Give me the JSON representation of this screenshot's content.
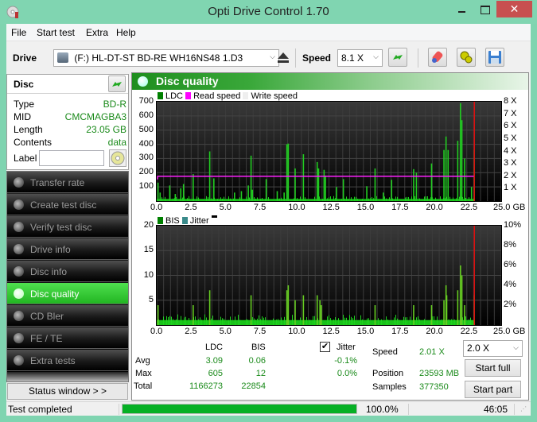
{
  "window": {
    "title": "Opti Drive Control 1.70",
    "close_glyph": "✕"
  },
  "menu": [
    "File",
    "Start test",
    "Extra",
    "Help"
  ],
  "toolbar": {
    "drive_label": "Drive",
    "drive_value": "(F:)  HL-DT-ST BD-RE  WH16NS48 1.D3",
    "speed_label": "Speed",
    "speed_value": "8.1 X",
    "icons": [
      "eject-icon",
      "refresh-icon",
      "erase-icon",
      "settings-icon",
      "save-icon"
    ]
  },
  "disc": {
    "header": "Disc",
    "rows": [
      {
        "label": "Type",
        "value": "BD-R"
      },
      {
        "label": "MID",
        "value": "CMCMAGBA3"
      },
      {
        "label": "Length",
        "value": "23.05 GB"
      },
      {
        "label": "Contents",
        "value": "data"
      }
    ],
    "label_field": {
      "label": "Label",
      "value": ""
    }
  },
  "nav": [
    {
      "label": "Transfer rate",
      "active": false
    },
    {
      "label": "Create test disc",
      "active": false
    },
    {
      "label": "Verify test disc",
      "active": false
    },
    {
      "label": "Drive info",
      "active": false
    },
    {
      "label": "Disc info",
      "active": false
    },
    {
      "label": "Disc quality",
      "active": true
    },
    {
      "label": "CD Bler",
      "active": false
    },
    {
      "label": "FE / TE",
      "active": false
    },
    {
      "label": "Extra tests",
      "active": false
    }
  ],
  "status_window_label": "Status window > >",
  "panel": {
    "title": "Disc quality"
  },
  "chart_data": [
    {
      "type": "bar",
      "title": "LDC",
      "legend": [
        "LDC",
        "Read speed",
        "Write speed"
      ],
      "legend_colors": {
        "LDC": "#008000",
        "Read speed": "#ff00ff",
        "Write speed": "#f0f0f0"
      },
      "xlabel": "GB",
      "x_ticks": [
        "0.0",
        "2.5",
        "5.0",
        "7.5",
        "10.0",
        "12.5",
        "15.0",
        "17.5",
        "20.0",
        "22.5",
        "25.0 GB"
      ],
      "xlim": [
        0,
        25
      ],
      "ylim": [
        0,
        700
      ],
      "y_ticks": [
        "700",
        "600",
        "500",
        "400",
        "300",
        "200",
        "100"
      ],
      "y2_ticks": [
        "8 X",
        "7 X",
        "6 X",
        "5 X",
        "4 X",
        "3 X",
        "2 X",
        "1 X"
      ],
      "y2lim": [
        0,
        8
      ],
      "end_marker_gb": 23.05,
      "read_speed_x": 2.0,
      "peaks": [
        [
          0.05,
          130
        ],
        [
          0.2,
          60
        ],
        [
          0.9,
          110
        ],
        [
          1.3,
          50
        ],
        [
          1.7,
          90
        ],
        [
          1.9,
          120
        ],
        [
          2.6,
          190
        ],
        [
          3.8,
          350
        ],
        [
          4.1,
          160
        ],
        [
          5.6,
          60
        ],
        [
          6.1,
          70
        ],
        [
          6.6,
          110
        ],
        [
          6.8,
          320
        ],
        [
          6.9,
          80
        ],
        [
          7.9,
          155
        ],
        [
          8.7,
          70
        ],
        [
          9.2,
          60
        ],
        [
          9.4,
          400
        ],
        [
          9.5,
          405
        ],
        [
          10.0,
          230
        ],
        [
          10.6,
          330
        ],
        [
          11.6,
          275
        ],
        [
          11.7,
          230
        ],
        [
          12.1,
          220
        ],
        [
          12.2,
          180
        ],
        [
          13.0,
          100
        ],
        [
          13.5,
          155
        ],
        [
          15.2,
          105
        ],
        [
          15.8,
          230
        ],
        [
          16.4,
          60
        ],
        [
          17.0,
          150
        ],
        [
          18.6,
          225
        ],
        [
          18.8,
          200
        ],
        [
          19.9,
          265
        ],
        [
          20.8,
          360
        ],
        [
          20.95,
          455
        ],
        [
          21.1,
          360
        ],
        [
          21.8,
          425
        ],
        [
          22.0,
          690
        ],
        [
          22.1,
          570
        ],
        [
          22.3,
          300
        ],
        [
          22.8,
          100
        ],
        [
          23.0,
          360
        ]
      ],
      "baseline": 15
    },
    {
      "type": "bar",
      "title": "BIS",
      "legend": [
        "BIS",
        "Jitter"
      ],
      "legend_colors": {
        "BIS": "#008000",
        "Jitter": "#3a8a8a"
      },
      "xlabel": "GB",
      "x_ticks": [
        "0.0",
        "2.5",
        "5.0",
        "7.5",
        "10.0",
        "12.5",
        "15.0",
        "17.5",
        "20.0",
        "22.5",
        "25.0 GB"
      ],
      "xlim": [
        0,
        25
      ],
      "ylim": [
        0,
        20
      ],
      "y_ticks": [
        "20",
        "15",
        "10",
        "5"
      ],
      "y2_ticks": [
        "10%",
        "8%",
        "6%",
        "4%",
        "2%"
      ],
      "y2lim": [
        0,
        10
      ],
      "end_marker_gb": 23.05,
      "peaks": [
        [
          0.05,
          4
        ],
        [
          2.6,
          4
        ],
        [
          3.8,
          7
        ],
        [
          6.8,
          6
        ],
        [
          9.4,
          7
        ],
        [
          9.5,
          8
        ],
        [
          10.0,
          5
        ],
        [
          10.6,
          6
        ],
        [
          11.6,
          6
        ],
        [
          11.8,
          5
        ],
        [
          11.9,
          4
        ],
        [
          15.8,
          4
        ],
        [
          18.6,
          4
        ],
        [
          19.9,
          4
        ],
        [
          20.8,
          5
        ],
        [
          20.95,
          8
        ],
        [
          21.0,
          6
        ],
        [
          21.8,
          7
        ],
        [
          22.0,
          12
        ],
        [
          22.1,
          10
        ],
        [
          22.3,
          4
        ],
        [
          23.0,
          6
        ]
      ],
      "baseline": 1
    }
  ],
  "stats": {
    "col_ldc": "LDC",
    "col_bis": "BIS",
    "col_jitter": "Jitter",
    "jitter_checked": true,
    "rows": [
      {
        "label": "Avg",
        "ldc": "3.09",
        "bis": "0.06",
        "jitter": "-0.1%"
      },
      {
        "label": "Max",
        "ldc": "605",
        "bis": "12",
        "jitter": "0.0%"
      },
      {
        "label": "Total",
        "ldc": "1166273",
        "bis": "22854",
        "jitter": ""
      }
    ],
    "speed_label": "Speed",
    "speed_value": "2.01 X",
    "position_label": "Position",
    "position_value": "23593 MB",
    "samples_label": "Samples",
    "samples_value": "377350",
    "speed_select": "2.0 X",
    "start_full": "Start full",
    "start_part": "Start part"
  },
  "statusbar": {
    "text": "Test completed",
    "progress_percent": 100.0,
    "progress_label": "100.0%",
    "time": "46:05"
  }
}
